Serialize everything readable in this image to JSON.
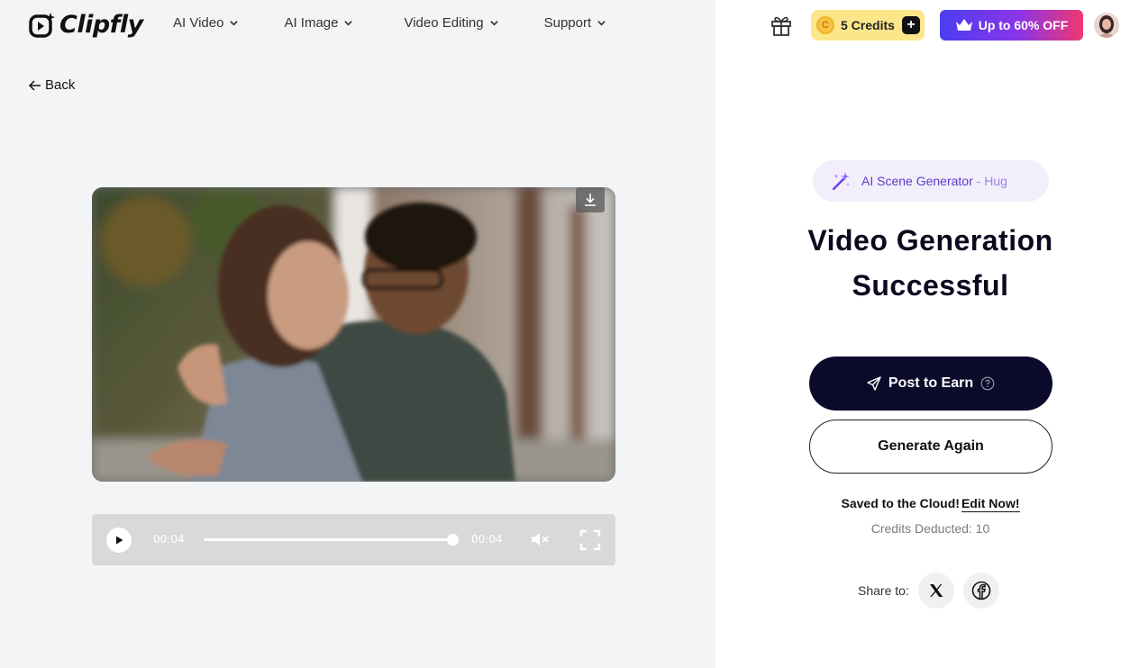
{
  "header": {
    "logo_text": "Clipfly",
    "nav": [
      {
        "label": "AI Video"
      },
      {
        "label": "AI Image"
      },
      {
        "label": "Video Editing"
      },
      {
        "label": "Support"
      }
    ],
    "credits_label": "5 Credits",
    "credits_coin": "C",
    "credits_plus": "+",
    "promo_label": "Up to 60% OFF"
  },
  "back_label": "Back",
  "player": {
    "current_time": "00:04",
    "duration": "00:04",
    "progress": 1.0
  },
  "panel": {
    "tag_name": "AI Scene Generator",
    "tag_separator": "-",
    "tag_scene": "Hug",
    "title_line1": "Video Generation",
    "title_line2": "Successful",
    "post_label": "Post to Earn",
    "generate_label": "Generate Again",
    "saved_text": "Saved to the Cloud!",
    "edit_link": "Edit Now!",
    "deducted_text": "Credits Deducted: 10",
    "share_label": "Share to:"
  },
  "colors": {
    "accent_dark": "#0c0a2a",
    "tag_text": "#5a3cc8",
    "credits_bg": "#fde68a",
    "promo_start": "#4b3df0",
    "promo_end": "#f1376e"
  },
  "icons": [
    "clipfly-logo-icon",
    "chevron-down-icon",
    "arrow-left-icon",
    "download-icon",
    "play-icon",
    "mute-icon",
    "fullscreen-icon",
    "gift-icon",
    "crown-icon",
    "magic-wand-icon",
    "send-icon",
    "help-icon",
    "x-twitter-icon",
    "facebook-icon"
  ]
}
